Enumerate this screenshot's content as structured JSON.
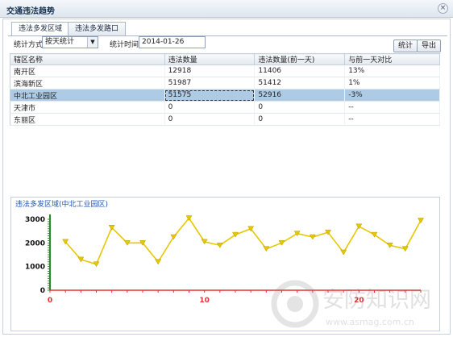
{
  "window": {
    "title": "交通违法趋势",
    "close_glyph": "×"
  },
  "tabs": [
    {
      "label": "违法多发区域",
      "active": true
    },
    {
      "label": "违法多发路口",
      "active": false
    }
  ],
  "toolbar": {
    "method_label": "统计方式",
    "method_value": "按天统计",
    "time_label": "统计时间",
    "time_value": "2014-01-26",
    "stats_button": "统计",
    "export_button": "导出"
  },
  "table": {
    "columns": [
      "辖区名称",
      "违法数量",
      "违法数量(前一天)",
      "与前一天对比"
    ],
    "rows": [
      [
        "南开区",
        "12918",
        "11406",
        "13%"
      ],
      [
        "滨海新区",
        "51987",
        "51412",
        "1%"
      ],
      [
        "中北工业园区",
        "51575",
        "52916",
        "-3%"
      ],
      [
        "天津市",
        "0",
        "0",
        "--"
      ],
      [
        "东丽区",
        "0",
        "0",
        "--"
      ]
    ],
    "selected_row": 2
  },
  "chart_title": "违法多发区域(中北工业园区)",
  "chart_data": {
    "type": "line",
    "title": "违法多发区域(中北工业园区)",
    "xlabel": "",
    "ylabel": "",
    "xlim": [
      0,
      24
    ],
    "ylim": [
      0,
      3000
    ],
    "x_ticks": [
      0,
      10,
      20
    ],
    "y_ticks": [
      0,
      1000,
      2000,
      3000
    ],
    "x": [
      1,
      2,
      3,
      4,
      5,
      6,
      7,
      8,
      9,
      10,
      11,
      12,
      13,
      14,
      15,
      16,
      17,
      18,
      19,
      20,
      21,
      22,
      23,
      24
    ],
    "y": [
      2050,
      1300,
      1100,
      2650,
      2000,
      2000,
      1200,
      2250,
      3050,
      2050,
      1900,
      2350,
      2600,
      1750,
      2000,
      2400,
      2250,
      2450,
      1600,
      2700,
      2350,
      1900,
      1750,
      2950
    ],
    "line_color": "#e6c800",
    "marker_color": "#e6c800",
    "x_axis_color": "#e53030",
    "y_axis_color": "#2a8a2a",
    "grid": false
  },
  "watermark": {
    "brand_cn": "安防知识网",
    "url": "www.asmag.com.cn"
  }
}
